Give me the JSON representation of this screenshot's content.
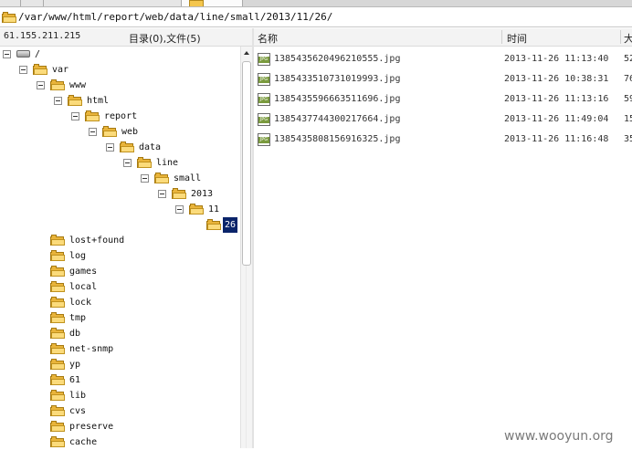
{
  "path_bar": {
    "path": "/var/www/html/report/web/data/line/small/2013/11/26/"
  },
  "header": {
    "server_ip": "61.155.211.215",
    "dir_summary": "目录(0),文件(5)",
    "col_name": "名称",
    "col_time": "时间",
    "col_size": "大"
  },
  "tree": {
    "root": "/",
    "var": "var",
    "www": "www",
    "html": "html",
    "report": "report",
    "web": "web",
    "data": "data",
    "line": "line",
    "small": "small",
    "y2013": "2013",
    "m11": "11",
    "d26": "26",
    "siblings": [
      "lost+found",
      "log",
      "games",
      "local",
      "lock",
      "tmp",
      "db",
      "net-snmp",
      "yp",
      "61",
      "lib",
      "cvs",
      "preserve",
      "cache"
    ]
  },
  "files": [
    {
      "name": "1385435620496210555.jpg",
      "time": "2013-11-26 11:13:40",
      "size": "52"
    },
    {
      "name": "1385433510731019993.jpg",
      "time": "2013-11-26 10:38:31",
      "size": "76"
    },
    {
      "name": "1385435596663511696.jpg",
      "time": "2013-11-26 11:13:16",
      "size": "59"
    },
    {
      "name": "1385437744300217664.jpg",
      "time": "2013-11-26 11:49:04",
      "size": "15"
    },
    {
      "name": "1385435808156916325.jpg",
      "time": "2013-11-26 11:16:48",
      "size": "35"
    }
  ],
  "watermark": "www.wooyun.org",
  "colors": {
    "selection": "#0a246a",
    "folder": "#e9b43a"
  }
}
